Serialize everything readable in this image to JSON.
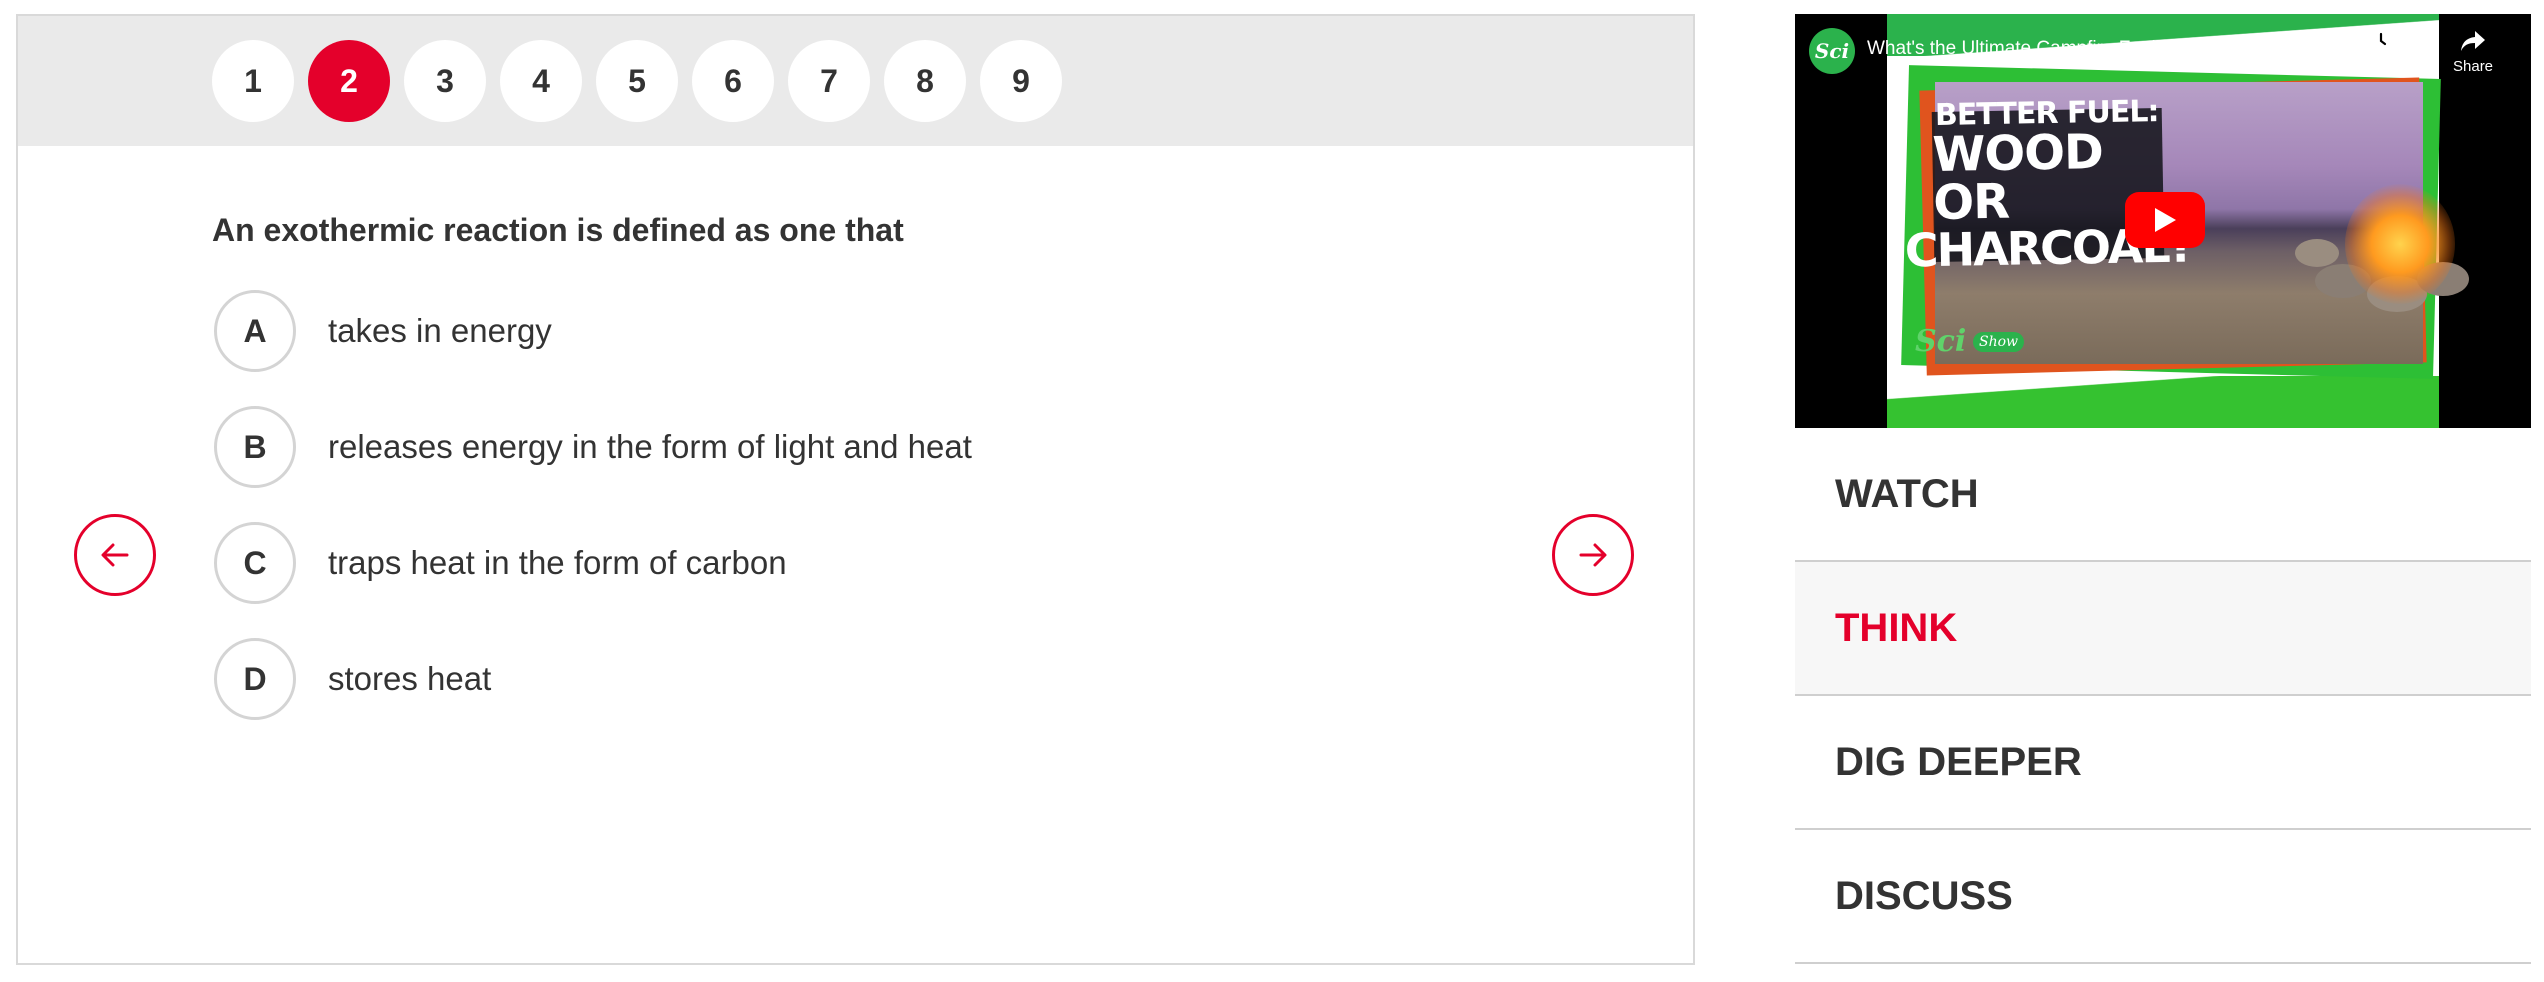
{
  "quiz": {
    "question_numbers": [
      "1",
      "2",
      "3",
      "4",
      "5",
      "6",
      "7",
      "8",
      "9"
    ],
    "active_question": "2",
    "question": "An exothermic reaction is defined as one that",
    "options": [
      {
        "letter": "A",
        "text": "takes in energy"
      },
      {
        "letter": "B",
        "text": "releases energy in the form of light and heat"
      },
      {
        "letter": "C",
        "text": "traps heat in the form of carbon"
      },
      {
        "letter": "D",
        "text": "stores heat"
      }
    ],
    "prev_icon": "arrow-left-icon",
    "next_icon": "arrow-right-icon"
  },
  "video": {
    "title": "What's the Ultimate Campfire Fuel?",
    "channel_logo": "Sci",
    "watch_later": "Watch later",
    "share": "Share",
    "thumbnail_text": {
      "line1": "BETTER FUEL:",
      "line2": "WOOD OR",
      "line3": "CHARCOAL?",
      "brand": "Sci",
      "brand_show": "Show"
    }
  },
  "tabs": [
    {
      "label": "WATCH",
      "active": false
    },
    {
      "label": "THINK",
      "active": true
    },
    {
      "label": "DIG DEEPER",
      "active": false
    },
    {
      "label": "DISCUSS",
      "active": false
    }
  ],
  "colors": {
    "accent": "#e4002b",
    "nav_bg": "#eaeaea",
    "text": "#333333",
    "youtube_red": "#ff0000",
    "scishow_green": "#2bb24c"
  }
}
